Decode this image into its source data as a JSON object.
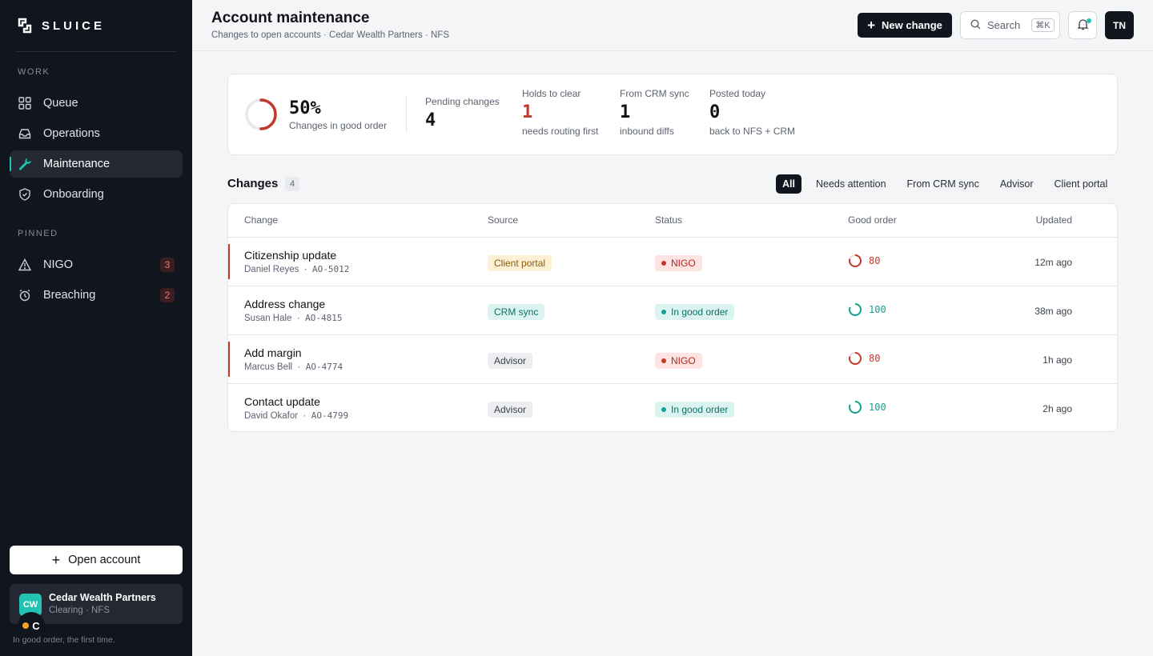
{
  "brand": {
    "name": "SLUICE"
  },
  "sidebar": {
    "work_heading": "WORK",
    "work_items": [
      {
        "label": "Queue",
        "icon": "grid-icon"
      },
      {
        "label": "Operations",
        "icon": "inbox-icon"
      },
      {
        "label": "Maintenance",
        "icon": "wrench-icon",
        "active": true
      },
      {
        "label": "Onboarding",
        "icon": "shield-check-icon"
      }
    ],
    "pinned_heading": "PINNED",
    "pinned_items": [
      {
        "label": "NIGO",
        "icon": "warning-icon",
        "count": "3"
      },
      {
        "label": "Breaching",
        "icon": "alarm-clock-icon",
        "count": "2"
      }
    ],
    "open_account_label": "Open account",
    "org": {
      "initials": "CW",
      "name": "Cedar Wealth Partners",
      "sub": "Clearing · NFS"
    },
    "status_letter": "C",
    "tagline": "In good order, the first time."
  },
  "header": {
    "title": "Account maintenance",
    "subtitle": "Changes to open accounts · Cedar Wealth Partners · NFS",
    "new_change_label": "New change",
    "search_label": "Search",
    "search_shortcut": "⌘K",
    "user_initials": "TN"
  },
  "stats": {
    "good_order_pct": "50%",
    "good_order_fraction": 0.5,
    "good_order_label": "Changes in good order",
    "items": [
      {
        "label": "Pending changes",
        "value": "4",
        "note": ""
      },
      {
        "label": "Holds to clear",
        "value": "1",
        "note": "needs routing first",
        "alert": true
      },
      {
        "label": "From CRM sync",
        "value": "1",
        "note": "inbound diffs"
      },
      {
        "label": "Posted today",
        "value": "0",
        "note": "back to NFS + CRM"
      }
    ]
  },
  "changes": {
    "title": "Changes",
    "count": "4",
    "filters": [
      "All",
      "Needs attention",
      "From CRM sync",
      "Advisor",
      "Client portal"
    ],
    "active_filter": "All",
    "columns": {
      "change": "Change",
      "source": "Source",
      "status": "Status",
      "good_order": "Good order",
      "updated": "Updated"
    },
    "rows": [
      {
        "title": "Citizenship update",
        "person": "Daniel Reyes",
        "id": "AO-5012",
        "source": "Client portal",
        "status": "NIGO",
        "score": "80",
        "updated": "12m ago"
      },
      {
        "title": "Address change",
        "person": "Susan Hale",
        "id": "AO-4815",
        "source": "CRM sync",
        "status": "In good order",
        "score": "100",
        "updated": "38m ago"
      },
      {
        "title": "Add margin",
        "person": "Marcus Bell",
        "id": "AO-4774",
        "source": "Advisor",
        "status": "NIGO",
        "score": "80",
        "updated": "1h ago"
      },
      {
        "title": "Contact update",
        "person": "David Okafor",
        "id": "AO-4799",
        "source": "Advisor",
        "status": "In good order",
        "score": "100",
        "updated": "2h ago"
      }
    ]
  },
  "colors": {
    "accent": "#22c3b2",
    "sidebar_bg": "#11151e",
    "danger": "#c0392b",
    "success": "#14a08f"
  }
}
